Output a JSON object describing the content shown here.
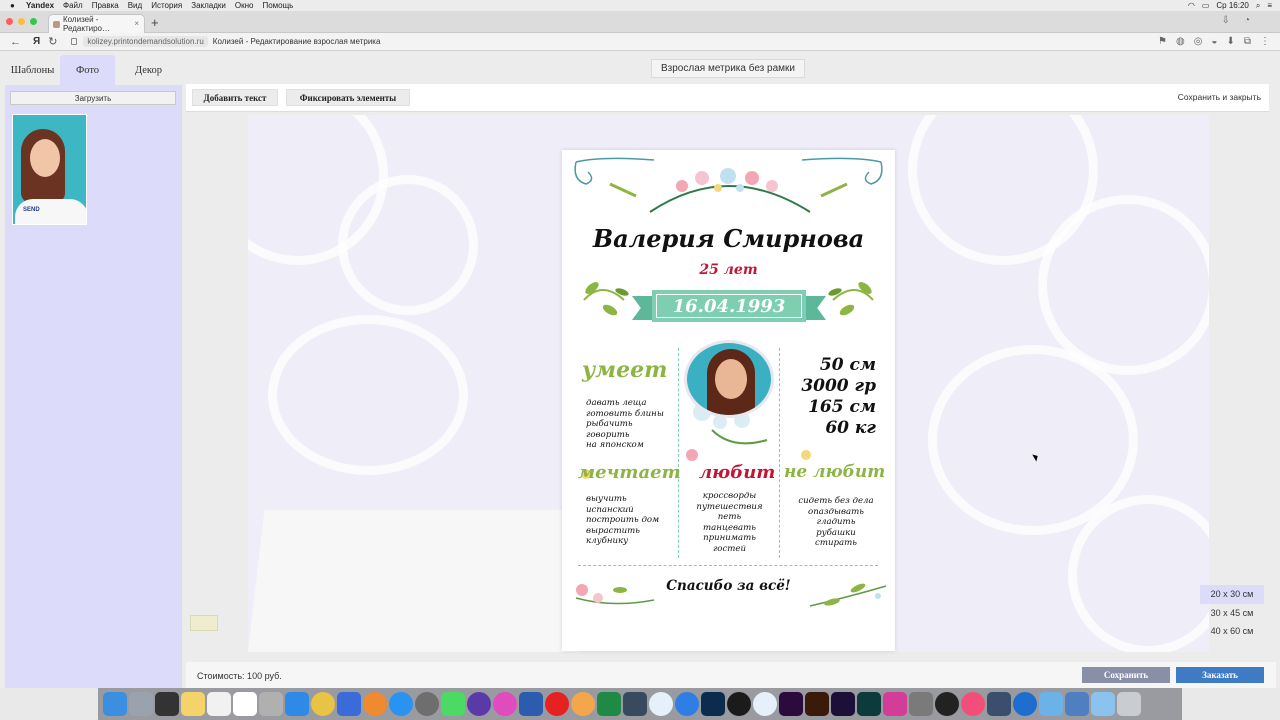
{
  "menubar": {
    "app": "Yandex",
    "items": [
      "Файл",
      "Правка",
      "Вид",
      "История",
      "Закладки",
      "Окно",
      "Помощь"
    ],
    "clock": "Ср 16:20"
  },
  "browser": {
    "tab_title": "Колизей - Редактиро…",
    "url": "kolizey.printondemandsolution.ru",
    "page_title": "Колизей - Редактирование взрослая метрика",
    "yandex_logo": "Я"
  },
  "editor": {
    "tabs": [
      "Шаблоны",
      "Фото",
      "Декор"
    ],
    "active_tab": "Фото",
    "upload_label": "Загрузить",
    "template_title": "Взрослая метрика без рамки",
    "toolbar": {
      "add_text": "Добавить текст",
      "fix_elements": "Фиксировать элементы",
      "save_close": "Сохранить и закрыть"
    },
    "sizes": [
      "20 x 30 см",
      "30 x 45 см",
      "40 x 60 см"
    ],
    "cost": "Стоимость: 100 руб.",
    "save": "Сохранить",
    "order": "Заказать"
  },
  "poster": {
    "name": "Валерия Смирнова",
    "age": "25 лет",
    "date": "16.04.1993",
    "skills_header": "умеет",
    "skills": [
      "давать леща",
      "готовить блины",
      "рыбачить",
      "говорить",
      "на японском"
    ],
    "measures": [
      "50 см",
      "3000 гр",
      "165 см",
      "60 кг"
    ],
    "dreams_header": "мечтает",
    "dreams": [
      "выучить",
      "испанский",
      "построить дом",
      "вырастить",
      "клубнику"
    ],
    "loves_header": "любит",
    "loves": [
      "кроссворды",
      "путешествия",
      "петь",
      "танцевать",
      "принимать",
      "гостей"
    ],
    "dislikes_header": "не любит",
    "dislikes": [
      "сидеть без дела",
      "опаздывать",
      "гладить",
      "рубашки",
      "стирать"
    ],
    "thanks": "Спасибо за всё!"
  },
  "thumb_shirt_text": "SEND",
  "colors": {
    "accent_red": "#c31433",
    "ribbon_green": "#7ecfb2",
    "header_green": "#8db544",
    "order_blue": "#3f7ac5",
    "panel_lavender": "#dcdcfa"
  }
}
